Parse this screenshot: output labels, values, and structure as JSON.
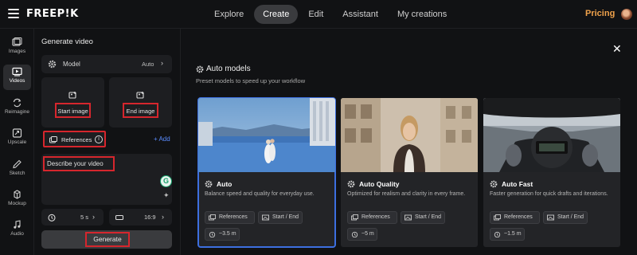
{
  "topbar": {
    "brand": "FREEP!K",
    "nav": [
      "Explore",
      "Create",
      "Edit",
      "Assistant",
      "My creations"
    ],
    "active_nav": "Create",
    "pricing": "Pricing"
  },
  "sidebar": {
    "items": [
      {
        "label": "Images",
        "icon": "image-icon"
      },
      {
        "label": "Videos",
        "icon": "video-icon",
        "active": true
      },
      {
        "label": "Reimagine",
        "icon": "refresh-icon"
      },
      {
        "label": "Upscale",
        "icon": "upscale-icon"
      },
      {
        "label": "Sketch",
        "icon": "pencil-icon"
      },
      {
        "label": "Mockup",
        "icon": "mockup-icon"
      },
      {
        "label": "Audio",
        "icon": "audio-icon"
      }
    ]
  },
  "panel": {
    "title": "Generate video",
    "model_label": "Model",
    "model_value": "Auto",
    "start_image": "Start image",
    "end_image": "End image",
    "references": "References",
    "add": "+ Add",
    "prompt_placeholder": "Describe your video",
    "duration": "5 s",
    "ratio": "16:9",
    "generate": "Generate"
  },
  "main": {
    "section_title": "Auto models",
    "section_subtitle": "Preset models to speed up your workflow",
    "cards": [
      {
        "title": "Auto",
        "description": "Balance speed and quality for everyday use.",
        "chip_refs": "References",
        "chip_frames": "Start / End",
        "time": "~3.5 m"
      },
      {
        "title": "Auto Quality",
        "description": "Optimized for realism and clarity in every frame.",
        "chip_refs": "References",
        "chip_frames": "Start / End",
        "time": "~5 m"
      },
      {
        "title": "Auto Fast",
        "description": "Faster generation for quick drafts and iterations.",
        "chip_refs": "References",
        "chip_frames": "Start / End",
        "time": "~1.5 m"
      }
    ]
  },
  "colors": {
    "accent": "#3d6fe0",
    "highlight": "#d6262d",
    "pricing": "#f0a24b",
    "link": "#5a8cff"
  }
}
